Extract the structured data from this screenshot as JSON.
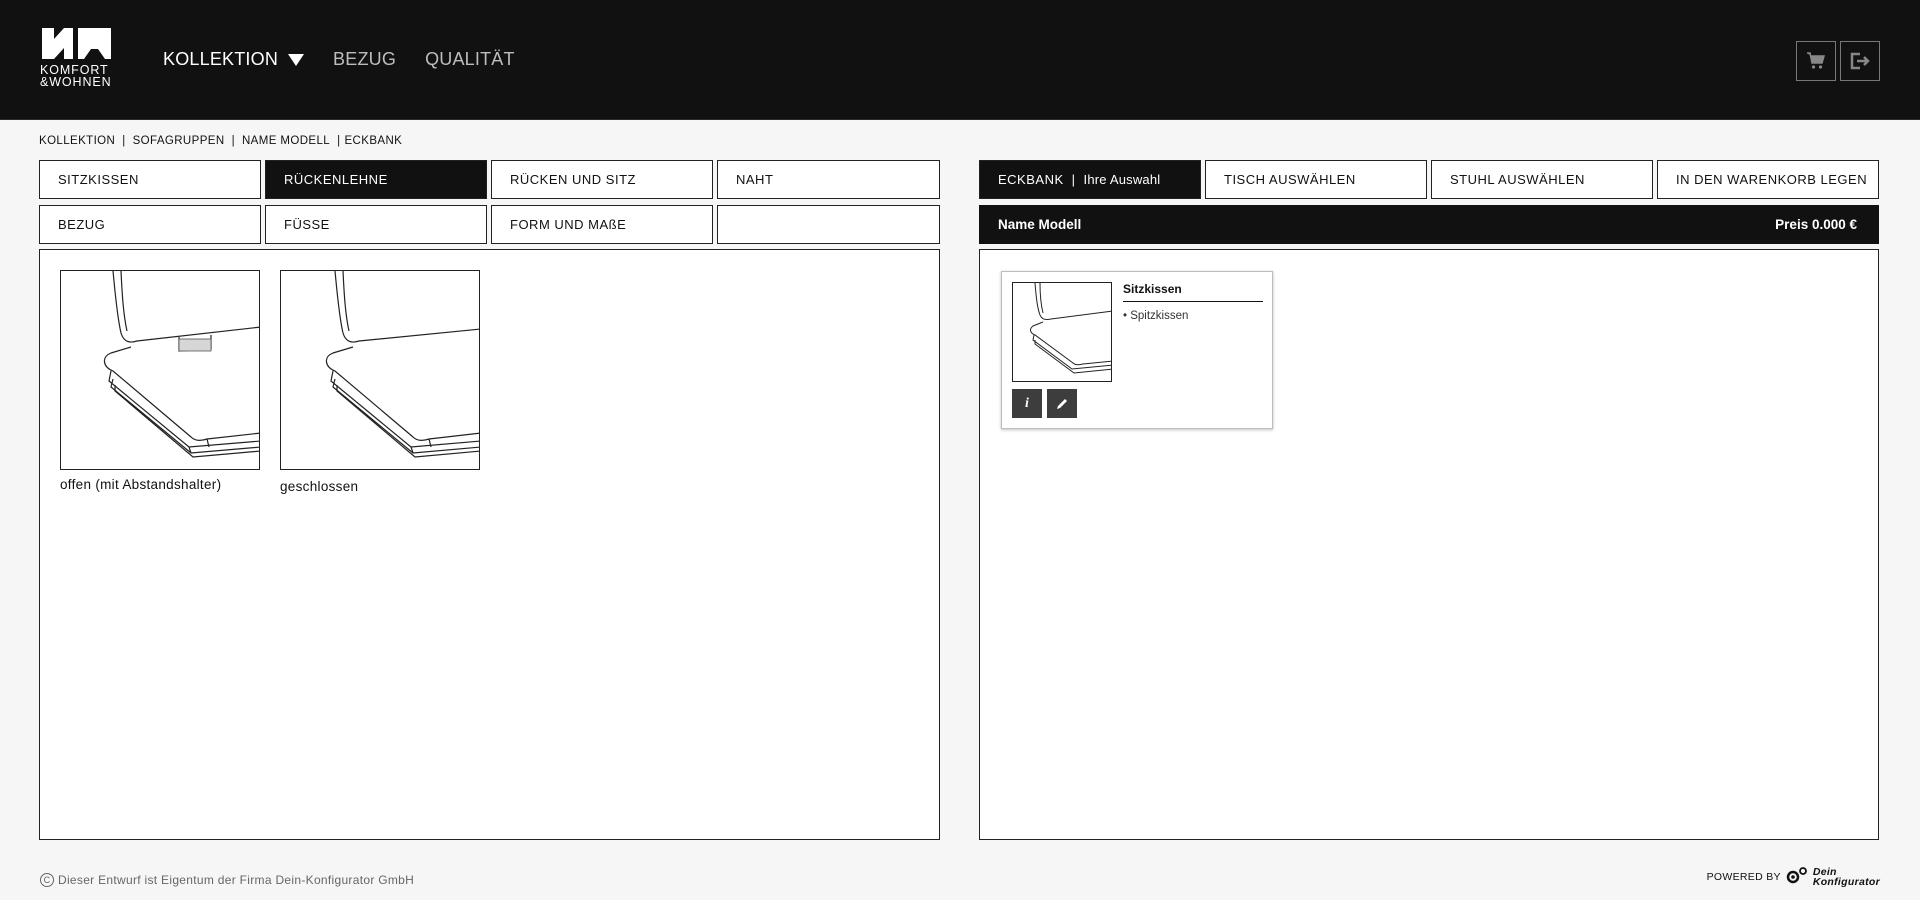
{
  "header": {
    "logo_text_line1": "KOMFORT",
    "logo_text_line2": "&WOHNEN",
    "nav": [
      {
        "label": "KOLLEKTION"
      },
      {
        "label": "BEZUG"
      },
      {
        "label": "QUALITÄT"
      }
    ],
    "icons": [
      "cart-icon",
      "logout-icon"
    ]
  },
  "breadcrumb": [
    "KOLLEKTION",
    "SOFAGRUPPEN",
    "NAME MODELL",
    "ECKBANK"
  ],
  "left_tabs": {
    "row1": [
      "SITZKISSEN",
      "RÜCKENLEHNE",
      "RÜCKEN UND SITZ",
      "NAHT"
    ],
    "row2": [
      "BEZUG",
      "FÜSSE",
      "FORM UND MAßE",
      ""
    ]
  },
  "options": [
    {
      "label": "offen (mit Abstandshalter)"
    },
    {
      "label": "geschlossen"
    }
  ],
  "right_tabs": {
    "eckbank": "ECKBANK",
    "eckbank_sub": "Ihre Auswahl",
    "tisch": "TISCH AUSWÄHLEN",
    "stuhl": "STUHL AUSWÄHLEN",
    "warenkorb": "IN DEN WARENKORB LEGEN"
  },
  "summary": {
    "model": "Name Modell",
    "price": "Preis 0.000 €"
  },
  "card": {
    "title": "Sitzkissen",
    "item": "• Spitzkissen",
    "buttons": [
      "info-icon",
      "pencil-icon"
    ]
  },
  "footer": {
    "left": "Dieser Entwurf ist Eigentum der Firma Dein-Konfigurator GmbH",
    "powered": "POWERED BY",
    "brand_line1": "Dein",
    "brand_line2": "Konfigurator"
  }
}
